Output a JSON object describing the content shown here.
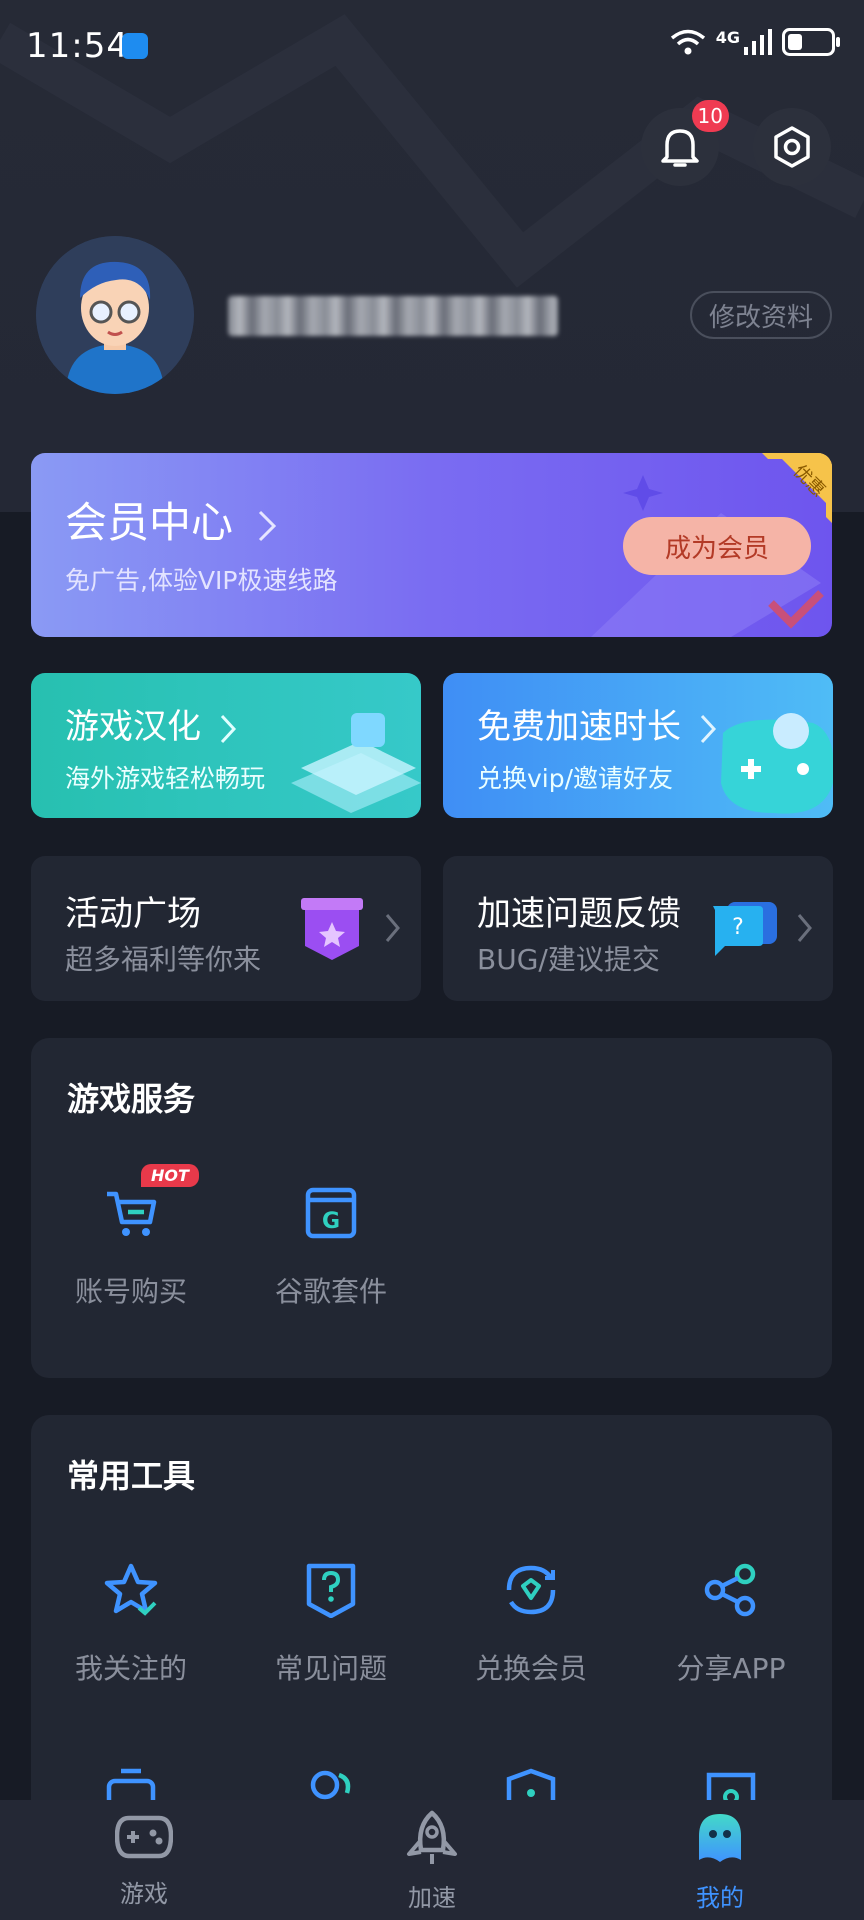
{
  "status_bar": {
    "time": "11:54",
    "network": "4G"
  },
  "header": {
    "notification_count": "10"
  },
  "profile": {
    "edit_label": "修改资料"
  },
  "member_card": {
    "title": "会员中心",
    "subtitle": "免广告,体验VIP极速线路",
    "cta": "成为会员",
    "corner_tag": "优惠"
  },
  "features": [
    {
      "title": "游戏汉化",
      "subtitle": "海外游戏轻松畅玩"
    },
    {
      "title": "免费加速时长",
      "subtitle": "兑换vip/邀请好友"
    }
  ],
  "cards": [
    {
      "title": "活动广场",
      "subtitle": "超多福利等你来"
    },
    {
      "title": "加速问题反馈",
      "subtitle": "BUG/建议提交"
    }
  ],
  "game_services": {
    "title": "游戏服务",
    "items": [
      {
        "label": "账号购买",
        "icon": "cart-icon",
        "badge": "HOT"
      },
      {
        "label": "谷歌套件",
        "icon": "google-suite-icon"
      }
    ]
  },
  "tools": {
    "title": "常用工具",
    "items": [
      {
        "label": "我关注的",
        "icon": "star-icon"
      },
      {
        "label": "常见问题",
        "icon": "question-icon"
      },
      {
        "label": "兑换会员",
        "icon": "exchange-icon"
      },
      {
        "label": "分享APP",
        "icon": "share-icon"
      }
    ]
  },
  "bottom_nav": {
    "items": [
      {
        "label": "游戏",
        "icon": "gamepad-icon"
      },
      {
        "label": "加速",
        "icon": "rocket-icon"
      },
      {
        "label": "我的",
        "icon": "mascot-icon",
        "active": true
      }
    ]
  },
  "colors": {
    "accent": "#3f93ff",
    "background": "#171b25",
    "card": "#222733",
    "badge": "#ef3b52"
  }
}
